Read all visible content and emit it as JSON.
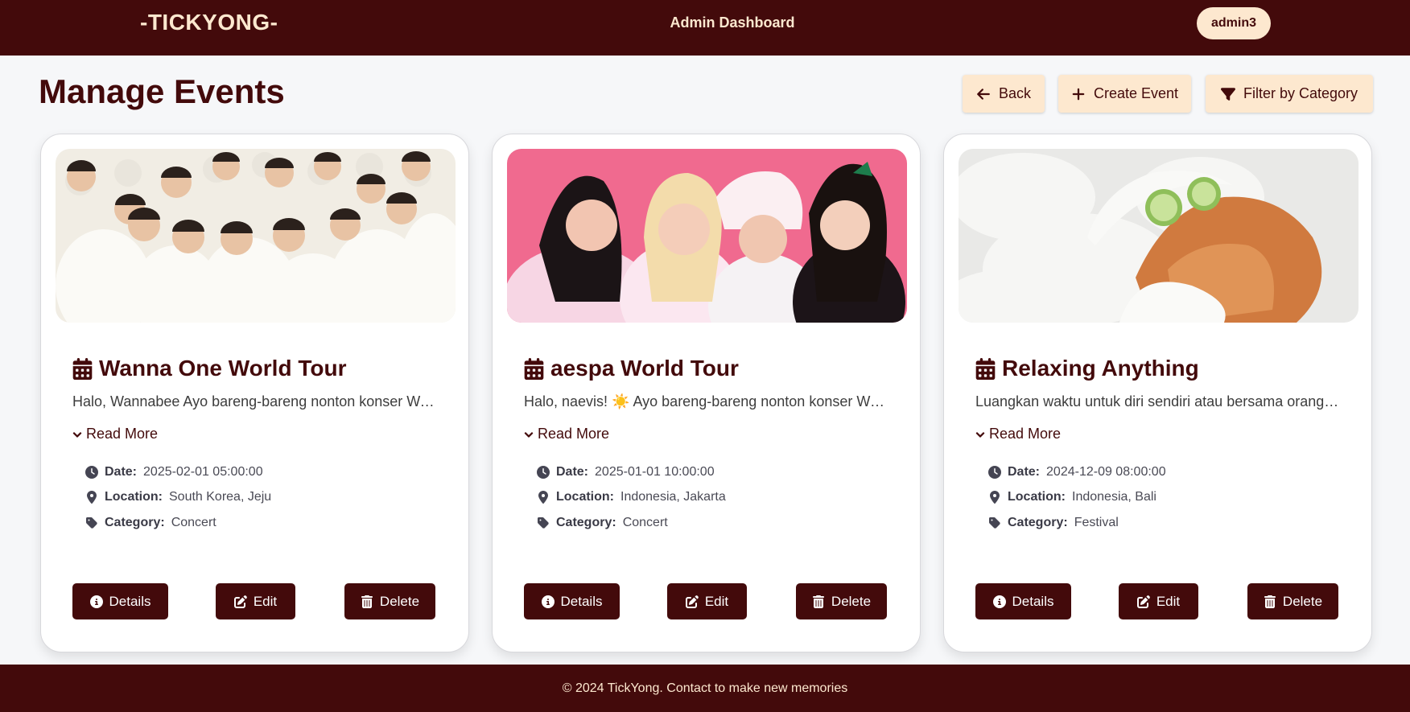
{
  "navbar": {
    "brand": "-TICKYONG-",
    "title": "Admin Dashboard",
    "user": "admin3"
  },
  "page": {
    "title": "Manage Events"
  },
  "toolbar": {
    "back_label": "Back",
    "create_label": "Create Event",
    "filter_label": "Filter by Category"
  },
  "events": [
    {
      "title": "Wanna One World Tour",
      "description": "Halo, Wannabee Ayo bareng-bareng nonton konser Wanna One World Tour",
      "read_more": "Read More",
      "date_label": "Date:",
      "date": "2025-02-01 05:00:00",
      "location_label": "Location:",
      "location": "South Korea, Jeju",
      "category_label": "Category:",
      "category": "Concert",
      "details_label": "Details",
      "edit_label": "Edit",
      "delete_label": "Delete",
      "image": "group-photo"
    },
    {
      "title": "aespa World Tour",
      "description": "Halo, naevis! ☀️ Ayo bareng-bareng nonton konser World Tour aespa",
      "read_more": "Read More",
      "date_label": "Date:",
      "date": "2025-01-01 10:00:00",
      "location_label": "Location:",
      "location": "Indonesia, Jakarta",
      "category_label": "Category:",
      "category": "Concert",
      "details_label": "Details",
      "edit_label": "Edit",
      "delete_label": "Delete",
      "image": "group-photo"
    },
    {
      "title": "Relaxing Anything",
      "description": "Luangkan waktu untuk diri sendiri atau bersama orang tersayang",
      "read_more": "Read More",
      "date_label": "Date:",
      "date": "2024-12-09 08:00:00",
      "location_label": "Location:",
      "location": "Indonesia, Bali",
      "category_label": "Category:",
      "category": "Festival",
      "details_label": "Details",
      "edit_label": "Edit",
      "delete_label": "Delete",
      "image": "cat-spa-photo"
    }
  ],
  "footer": {
    "text": "© 2024 TickYong. Contact to make new memories"
  },
  "colors": {
    "primary": "#430a0b",
    "accent": "#fde8cf",
    "background": "#f6f7f9"
  }
}
